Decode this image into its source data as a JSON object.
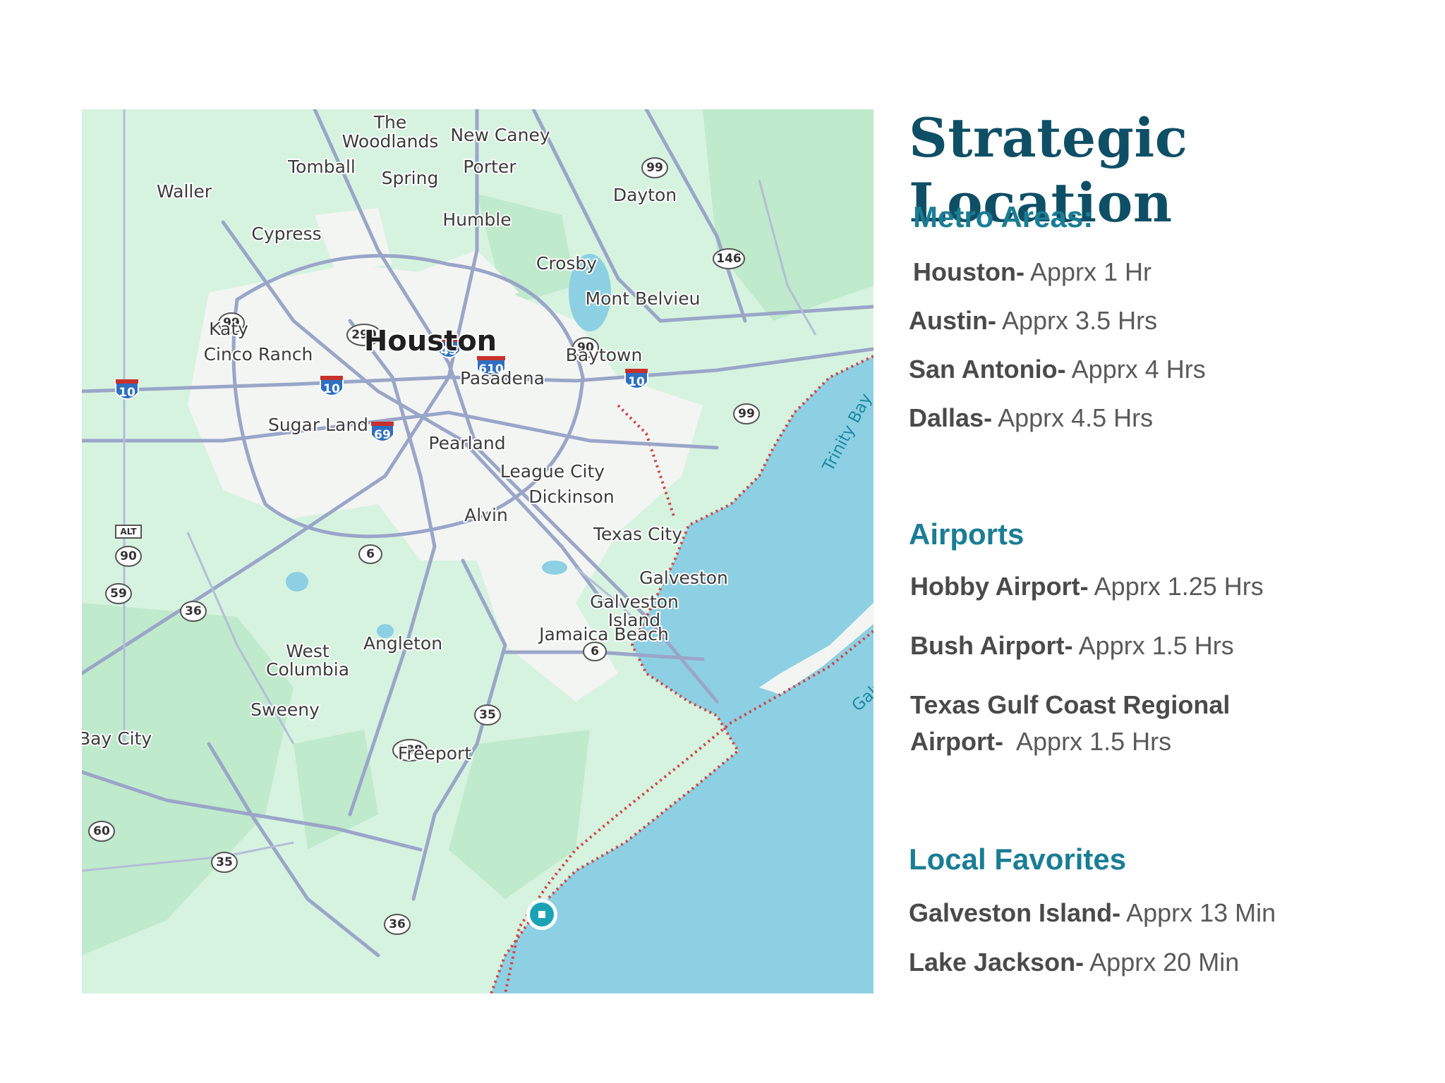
{
  "title": "Strategic Location",
  "sections": [
    {
      "heading": "Metro Areas:",
      "items": [
        {
          "name": "Houston-",
          "time": "Apprx 1 Hr"
        },
        {
          "name": "Austin-",
          "time": "Apprx 3.5 Hrs"
        },
        {
          "name": "San Antonio-",
          "time": "Apprx 4 Hrs"
        },
        {
          "name": "Dallas-",
          "time": "Apprx 4.5 Hrs"
        }
      ]
    },
    {
      "heading": "Airports",
      "items": [
        {
          "name": "Hobby Airport-",
          "time": "Apprx 1.25 Hrs"
        },
        {
          "name": "Bush Airport-",
          "time": "Apprx 1.5 Hrs"
        },
        {
          "name": "Texas Gulf Coast Regional",
          "name2": "Airport-",
          "time": "Apprx 1.5 Hrs"
        }
      ]
    },
    {
      "heading": "Local Favorites",
      "items": [
        {
          "name": "Galveston Island-",
          "time": "Apprx 13 Min"
        },
        {
          "name": "Lake Jackson-",
          "time": "Apprx 20 Min"
        }
      ]
    }
  ],
  "map": {
    "colors": {
      "land": "#d6f3df",
      "urban": "#f4f4f4",
      "water": "#8dd0e3",
      "road": "#9aa6c8",
      "park": "#bfeacb",
      "coast": "#d04a4a",
      "marker": "#19a3b5"
    },
    "places": {
      "the_woodlands": "The Woodlands",
      "new_caney": "New Caney",
      "tomball": "Tomball",
      "porter": "Porter",
      "spring": "Spring",
      "waller": "Waller",
      "humble": "Humble",
      "dayton": "Dayton",
      "cypress": "Cypress",
      "crosby": "Crosby",
      "mont_belvieu": "Mont Belvieu",
      "katy": "Katy",
      "houston": "Houston",
      "baytown": "Baytown",
      "cinco_ranch": "Cinco Ranch",
      "pasadena": "Pasadena",
      "sugar_land": "Sugar Land",
      "pearland": "Pearland",
      "league_city": "League City",
      "dickinson": "Dickinson",
      "alvin": "Alvin",
      "texas_city": "Texas City",
      "galveston": "Galveston",
      "galveston_island": "Galveston Island",
      "jamaica_beach": "Jamaica Beach",
      "angleton": "Angleton",
      "west_columbia": "West Columbia",
      "sweeny": "Sweeny",
      "freeport": "Freeport",
      "bay_city": "Bay City",
      "trinity_bay": "Trinity Bay",
      "galveston_bay": "Galveston Bay"
    },
    "shields": {
      "us99a": "99",
      "us99b": "99",
      "us99c": "99",
      "us290": "290",
      "us90": "90",
      "us146": "146",
      "us6a": "6",
      "us6b": "6",
      "us59": "59",
      "us90b": "90",
      "us36a": "36",
      "us36b": "36",
      "us35a": "35",
      "us35b": "35",
      "us288": "288",
      "us60": "60",
      "alt": "ALT",
      "i10a": "10",
      "i10b": "10",
      "i10c": "10",
      "i45": "45",
      "i610": "610",
      "i69": "69"
    }
  }
}
